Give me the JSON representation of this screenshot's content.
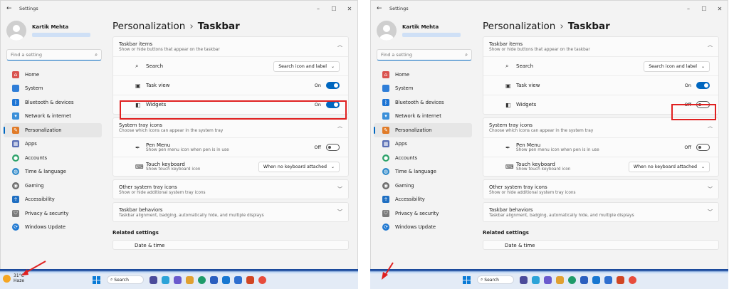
{
  "app_title": "Settings",
  "user": {
    "name": "Kartik Mehta"
  },
  "search": {
    "placeholder": "Find a setting"
  },
  "nav": [
    {
      "label": "Home",
      "icon": "home-icon",
      "color": "#d9534f"
    },
    {
      "label": "System",
      "icon": "system-icon",
      "color": "#2f7ed8"
    },
    {
      "label": "Bluetooth & devices",
      "icon": "bluetooth-icon",
      "color": "#1c74d4"
    },
    {
      "label": "Network & internet",
      "icon": "network-icon",
      "color": "#3a8fd9"
    },
    {
      "label": "Personalization",
      "icon": "brush-icon",
      "color": "#e07b28"
    },
    {
      "label": "Apps",
      "icon": "apps-icon",
      "color": "#5a6fb5"
    },
    {
      "label": "Accounts",
      "icon": "accounts-icon",
      "color": "#2fa36b"
    },
    {
      "label": "Time & language",
      "icon": "globe-icon",
      "color": "#2e89c9"
    },
    {
      "label": "Gaming",
      "icon": "gaming-icon",
      "color": "#6b6b6b"
    },
    {
      "label": "Accessibility",
      "icon": "accessibility-icon",
      "color": "#1f6fc2"
    },
    {
      "label": "Privacy & security",
      "icon": "shield-icon",
      "color": "#7a7a7a"
    },
    {
      "label": "Windows Update",
      "icon": "update-icon",
      "color": "#1f78d1"
    }
  ],
  "breadcrumb": {
    "parent": "Personalization",
    "current": "Taskbar"
  },
  "taskbar_items": {
    "title": "Taskbar items",
    "subtitle": "Show or hide buttons that appear on the taskbar",
    "search_label": "Search",
    "search_value": "Search icon and label",
    "task_view_label": "Task view",
    "widgets_label": "Widgets"
  },
  "tray": {
    "title": "System tray icons",
    "subtitle": "Choose which icons can appear in the system tray",
    "pen_label": "Pen Menu",
    "pen_sub": "Show pen menu icon when pen is in use",
    "pen_state": "Off",
    "touch_label": "Touch keyboard",
    "touch_sub": "Show touch keyboard icon",
    "touch_value": "When no keyboard attached"
  },
  "other_tray": {
    "title": "Other system tray icons",
    "subtitle": "Show or hide additional system tray icons"
  },
  "behaviors": {
    "title": "Taskbar behaviors",
    "subtitle": "Taskbar alignment, badging, automatically hide, and multiple displays"
  },
  "related": {
    "title": "Related settings",
    "date_time": "Date & time"
  },
  "left_panel": {
    "task_view_state": "On",
    "widgets_state": "On"
  },
  "right_panel": {
    "task_view_state": "On",
    "widgets_state": "Off"
  },
  "taskbar": {
    "search_label": "Search",
    "weather_temp": "31°C",
    "weather_desc": "Haze"
  },
  "colors": {
    "accent": "#0067c0",
    "highlight": "#e02020"
  }
}
